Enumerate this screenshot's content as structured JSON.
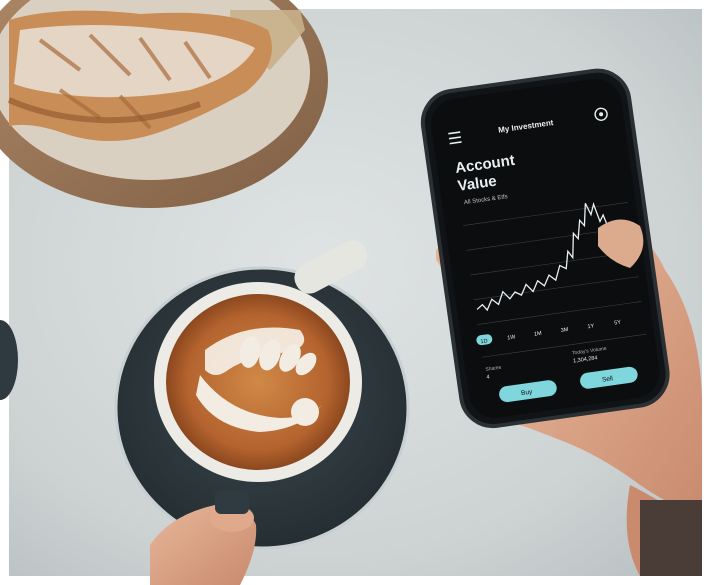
{
  "app": {
    "title": "My Investment",
    "heading_line1": "Account",
    "heading_line2": "Value",
    "subtitle": "All Stocks & Etfs",
    "accent_color": "#7fd6dc",
    "screen_color": "#0b0d0f"
  },
  "range_tabs": [
    {
      "label": "1D",
      "selected": true
    },
    {
      "label": "1W",
      "selected": false
    },
    {
      "label": "1M",
      "selected": false
    },
    {
      "label": "3M",
      "selected": false
    },
    {
      "label": "1Y",
      "selected": false
    },
    {
      "label": "5Y",
      "selected": false
    }
  ],
  "stats": {
    "shares_label": "Shares",
    "shares_value": "4",
    "equity_label": "Today's Volume",
    "equity_value": "1,304,284"
  },
  "actions": {
    "buy_label": "Buy",
    "sell_label": "Sell"
  },
  "icons": {
    "menu": "menu-icon",
    "settings": "settings-icon"
  },
  "scene": {
    "table_color": "#c9cfd0",
    "saucer_color": "#2f3b40",
    "cup_color": "#eeeeea",
    "coffee_color": "#b86a33",
    "plate_color": "#9b7758",
    "croissant_color": "#c98d57"
  }
}
